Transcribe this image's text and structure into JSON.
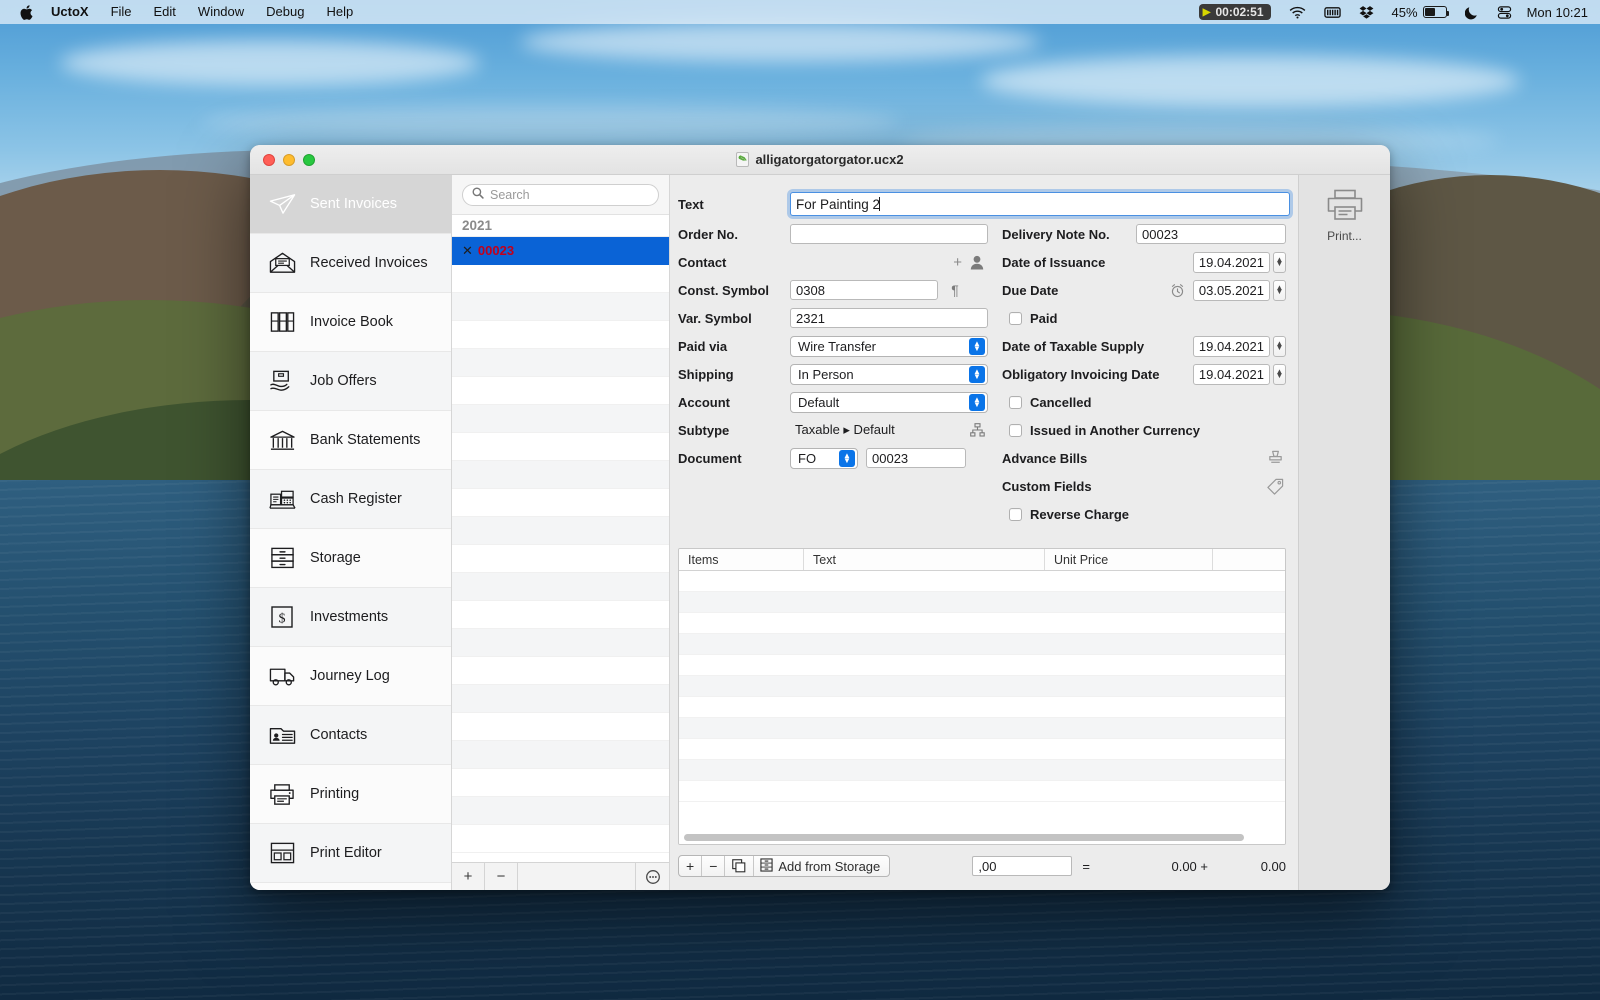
{
  "menubar": {
    "apple_icon": "apple-logo-icon",
    "app_name": "UctoX",
    "items": [
      "File",
      "Edit",
      "Window",
      "Debug",
      "Help"
    ],
    "status": {
      "timer": "00:02:51",
      "timer_play_icon": "play-icon",
      "wifi_icon": "wifi-icon",
      "battery_menu_icon": "battery-menu-icon",
      "dropbox_icon": "dropbox-icon",
      "battery_percent": "45%",
      "moon_icon": "do-not-disturb-moon-icon",
      "control_center_icon": "control-center-icon",
      "clock": "Mon 10:21"
    }
  },
  "window": {
    "title": "alligatorgatorgator.ucx2",
    "doc_icon": "document-icon"
  },
  "sidebar": {
    "items": [
      {
        "label": "Sent Invoices",
        "icon": "paper-plane-icon",
        "selected": true
      },
      {
        "label": "Received Invoices",
        "icon": "open-envelope-icon",
        "selected": false
      },
      {
        "label": "Invoice Book",
        "icon": "books-icon",
        "selected": false
      },
      {
        "label": "Job Offers",
        "icon": "handshake-box-icon",
        "selected": false
      },
      {
        "label": "Bank Statements",
        "icon": "bank-icon",
        "selected": false
      },
      {
        "label": "Cash Register",
        "icon": "cash-register-icon",
        "selected": false
      },
      {
        "label": "Storage",
        "icon": "drawers-icon",
        "selected": false
      },
      {
        "label": "Investments",
        "icon": "dollar-square-icon",
        "selected": false
      },
      {
        "label": "Journey Log",
        "icon": "truck-icon",
        "selected": false
      },
      {
        "label": "Contacts",
        "icon": "contact-card-icon",
        "selected": false
      },
      {
        "label": "Printing",
        "icon": "printer-icon",
        "selected": false
      },
      {
        "label": "Print Editor",
        "icon": "layout-editor-icon",
        "selected": false
      }
    ]
  },
  "list": {
    "search": {
      "placeholder": "Search",
      "value": "",
      "icon": "search-icon"
    },
    "group_label": "2021",
    "rows": [
      {
        "marker": "✕",
        "label": "00023",
        "selected": true
      }
    ],
    "footer": {
      "add": "+",
      "remove": "−",
      "more": "more-options-icon"
    }
  },
  "form": {
    "left": {
      "text": {
        "label": "Text",
        "value": "For Painting 2",
        "focused": true
      },
      "order_no": {
        "label": "Order No.",
        "value": ""
      },
      "contact": {
        "label": "Contact",
        "add_icon": "plus-icon",
        "person_icon": "person-icon"
      },
      "const_symbol": {
        "label": "Const. Symbol",
        "value": "0308",
        "trailing_icon": "pilcrow-icon"
      },
      "var_symbol": {
        "label": "Var. Symbol",
        "value": "2321"
      },
      "paid_via": {
        "label": "Paid via",
        "value": "Wire Transfer"
      },
      "shipping": {
        "label": "Shipping",
        "value": "In Person"
      },
      "account": {
        "label": "Account",
        "value": "Default"
      },
      "subtype": {
        "label": "Subtype",
        "value": "Taxable ▸ Default",
        "trailing_icon": "hierarchy-icon"
      },
      "document": {
        "label": "Document",
        "select_value": "FO",
        "number_value": "00023"
      }
    },
    "right": {
      "delivery_note_no": {
        "label": "Delivery Note No.",
        "value": "00023"
      },
      "date_of_issuance": {
        "label": "Date of Issuance",
        "value": "19.04.2021"
      },
      "due_date": {
        "label": "Due Date",
        "value": "03.05.2021",
        "alarm_icon": "alarm-clock-icon"
      },
      "paid": {
        "label": "Paid",
        "checked": false
      },
      "date_of_taxable_supply": {
        "label": "Date of Taxable Supply",
        "value": "19.04.2021"
      },
      "obligatory_invoicing_date": {
        "label": "Obligatory Invoicing Date",
        "value": "19.04.2021"
      },
      "cancelled": {
        "label": "Cancelled",
        "checked": false
      },
      "issued_in_another_currency": {
        "label": "Issued in Another Currency",
        "checked": false
      },
      "advance_bills": {
        "label": "Advance Bills",
        "icon": "stamp-icon"
      },
      "custom_fields": {
        "label": "Custom Fields",
        "icon": "tag-icon"
      },
      "reverse_charge": {
        "label": "Reverse Charge",
        "checked": false
      }
    }
  },
  "items_table": {
    "columns": [
      "Items",
      "Text",
      "Unit Price",
      ""
    ],
    "rows": []
  },
  "bottom_bar": {
    "add": "+",
    "remove": "−",
    "duplicate_icon": "duplicate-icon",
    "storage_icon": "storage-icon",
    "add_from_storage": "Add from Storage",
    "sum_field": ",00",
    "equals": "=",
    "total_net": "0.00 +",
    "total_tax": "0.00"
  },
  "right_strip": {
    "print": {
      "label": "Print...",
      "icon": "printer-icon"
    }
  },
  "colors": {
    "selection_blue": "#0a63d6",
    "accent_blue": "#0a74e8",
    "focus_ring": "#4a90e2",
    "invoice_red": "#c2001b",
    "window_bg": "#ececec"
  }
}
